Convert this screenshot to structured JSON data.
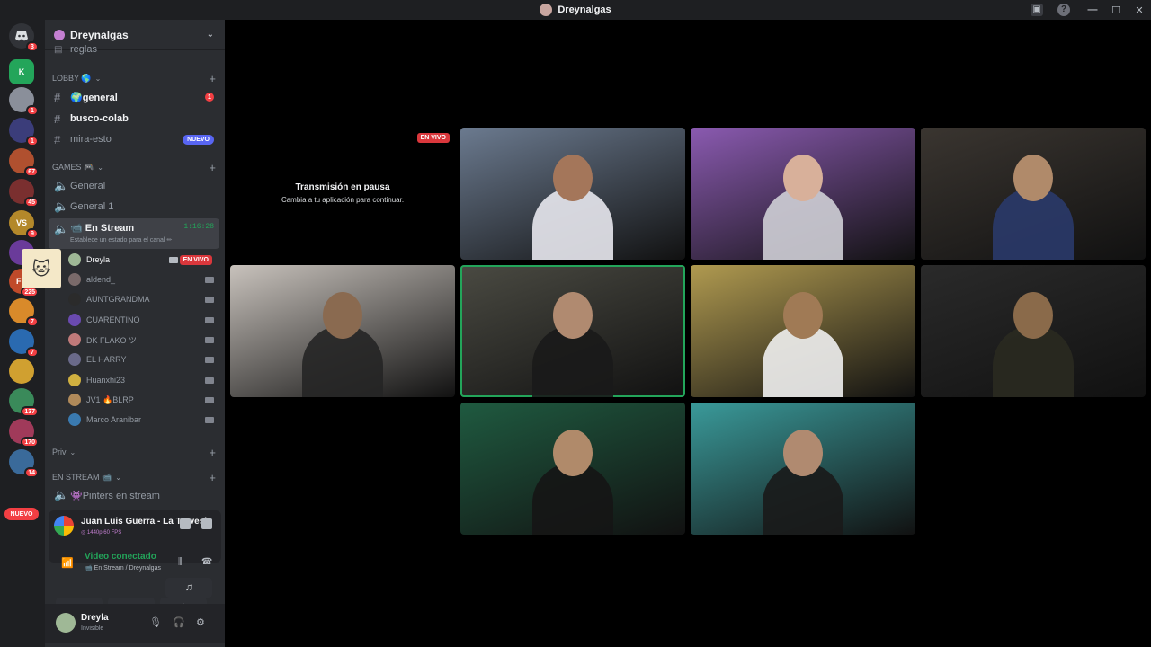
{
  "window": {
    "title": "Dreynalgas",
    "controls": [
      "—",
      "☐",
      "✕"
    ],
    "help_icon": "?"
  },
  "servers": {
    "home_badge": "3",
    "items": [
      {
        "name": "server-k",
        "color": "#23a55a",
        "glyph": "K",
        "badge": ""
      },
      {
        "name": "server-dreynalgas",
        "color": "#8a8f9a",
        "glyph": "",
        "badge": "1"
      },
      {
        "name": "server-3",
        "color": "#3b3d7a",
        "glyph": "",
        "badge": "1"
      },
      {
        "name": "server-4",
        "color": "#b0502f",
        "glyph": "",
        "badge": "67"
      },
      {
        "name": "server-5",
        "color": "#7a2f2f",
        "glyph": "",
        "badge": "45"
      },
      {
        "name": "server-vallesauce",
        "color": "#b3882a",
        "glyph": "VS",
        "badge": "9"
      },
      {
        "name": "server-7",
        "color": "#6a3b9a",
        "glyph": "",
        "badge": "4"
      },
      {
        "name": "server-8",
        "color": "#c04a2a",
        "glyph": "FR",
        "badge": "225"
      },
      {
        "name": "server-9",
        "color": "#d98a2a",
        "glyph": "",
        "badge": "7"
      },
      {
        "name": "server-10",
        "color": "#2a6ab0",
        "glyph": "",
        "badge": "7"
      },
      {
        "name": "server-11",
        "color": "#d0a030",
        "glyph": "",
        "badge": ""
      },
      {
        "name": "server-12",
        "color": "#3a8a5a",
        "glyph": "",
        "badge": "137"
      },
      {
        "name": "server-13",
        "color": "#a03a5a",
        "glyph": "",
        "badge": "170"
      },
      {
        "name": "server-14",
        "color": "#3a6a9a",
        "glyph": "",
        "badge": "14"
      }
    ],
    "nuevo_label": "NUEVO"
  },
  "sidebar": {
    "guild_name": "Dreynalgas",
    "partial_channel": "reglas",
    "categories": {
      "lobby": "LOBBY 🌎",
      "games": "GAMES 🎮",
      "priv": "Priv",
      "en_stream": "EN STREAM 📹"
    },
    "channels": {
      "general": "🌍general",
      "general_mentions": "1",
      "busco_colab": "busco-colab",
      "mira_esto": "mira-esto",
      "mira_esto_tag": "NUEVO",
      "voice_general": "General",
      "voice_general1": "General 1",
      "en_stream": "📹 En Stream",
      "en_stream_timer": "1:16:28",
      "en_stream_hint": "Establece un estado para el canal ✏",
      "pinters": "👾Pinters en stream"
    },
    "voice_users": [
      {
        "name": "Dreyla",
        "color": "#9fb896",
        "live": "EN VIVO",
        "me": true
      },
      {
        "name": "aldend_",
        "color": "#7a6a6a"
      },
      {
        "name": "AUNTGRANDMA",
        "color": "#2b2b2b"
      },
      {
        "name": "CUARENTINO",
        "color": "#6a4ab0"
      },
      {
        "name": "DK FLAKO ツ",
        "color": "#c07a7a"
      },
      {
        "name": "EL HARRY",
        "color": "#6a6a8a"
      },
      {
        "name": "Huanxhi23",
        "color": "#d0b040"
      },
      {
        "name": "JV1 🔥BLRP",
        "color": "#b08a5a"
      },
      {
        "name": "Marco Aranibar",
        "color": "#3a7ab0"
      }
    ]
  },
  "activity": {
    "title": "Juan Luis Guerra - La Travesia (Lyric Video)",
    "quality": "◎ 1440p 60 FPS"
  },
  "voice": {
    "status": "Video conectado",
    "location": "📹 En Stream / Dreynalgas"
  },
  "user": {
    "name": "Dreyla",
    "status": "Invisible"
  },
  "stage": {
    "paused_title": "Transmisión en pausa",
    "paused_sub": "Cambia a tu aplicación para continuar.",
    "live_tag": "EN VIVO",
    "tiles": [
      {
        "name": "video-tile-1",
        "bg": "#6b7a8f",
        "shirt": "#e8e8ee",
        "skin": "#a4765a"
      },
      {
        "name": "video-tile-2",
        "bg": "#8a5ab0",
        "shirt": "#cfcfd6",
        "skin": "#d8b09a"
      },
      {
        "name": "video-tile-3",
        "bg": "#3a3530",
        "shirt": "#2a3a6a",
        "skin": "#b08a6a"
      },
      {
        "name": "video-tile-4",
        "bg": "#c8c2bc",
        "shirt": "#252525",
        "skin": "#8a6a50"
      },
      {
        "name": "video-tile-5",
        "bg": "#4a4a42",
        "shirt": "#1a1a1a",
        "skin": "#b08a70",
        "speaking": true
      },
      {
        "name": "video-tile-6",
        "bg": "#b09a50",
        "shirt": "#f0f0f0",
        "skin": "#a07a55"
      },
      {
        "name": "video-tile-7",
        "bg": "#2a2a2a",
        "shirt": "#2a2a20",
        "skin": "#8a6a4a"
      },
      {
        "name": "video-tile-8",
        "bg": "#1f5a40",
        "shirt": "#151515",
        "skin": "#b08a6a"
      },
      {
        "name": "video-tile-9",
        "bg": "#3a9a9a",
        "shirt": "#1a1a1a",
        "skin": "#b08a70"
      }
    ]
  }
}
